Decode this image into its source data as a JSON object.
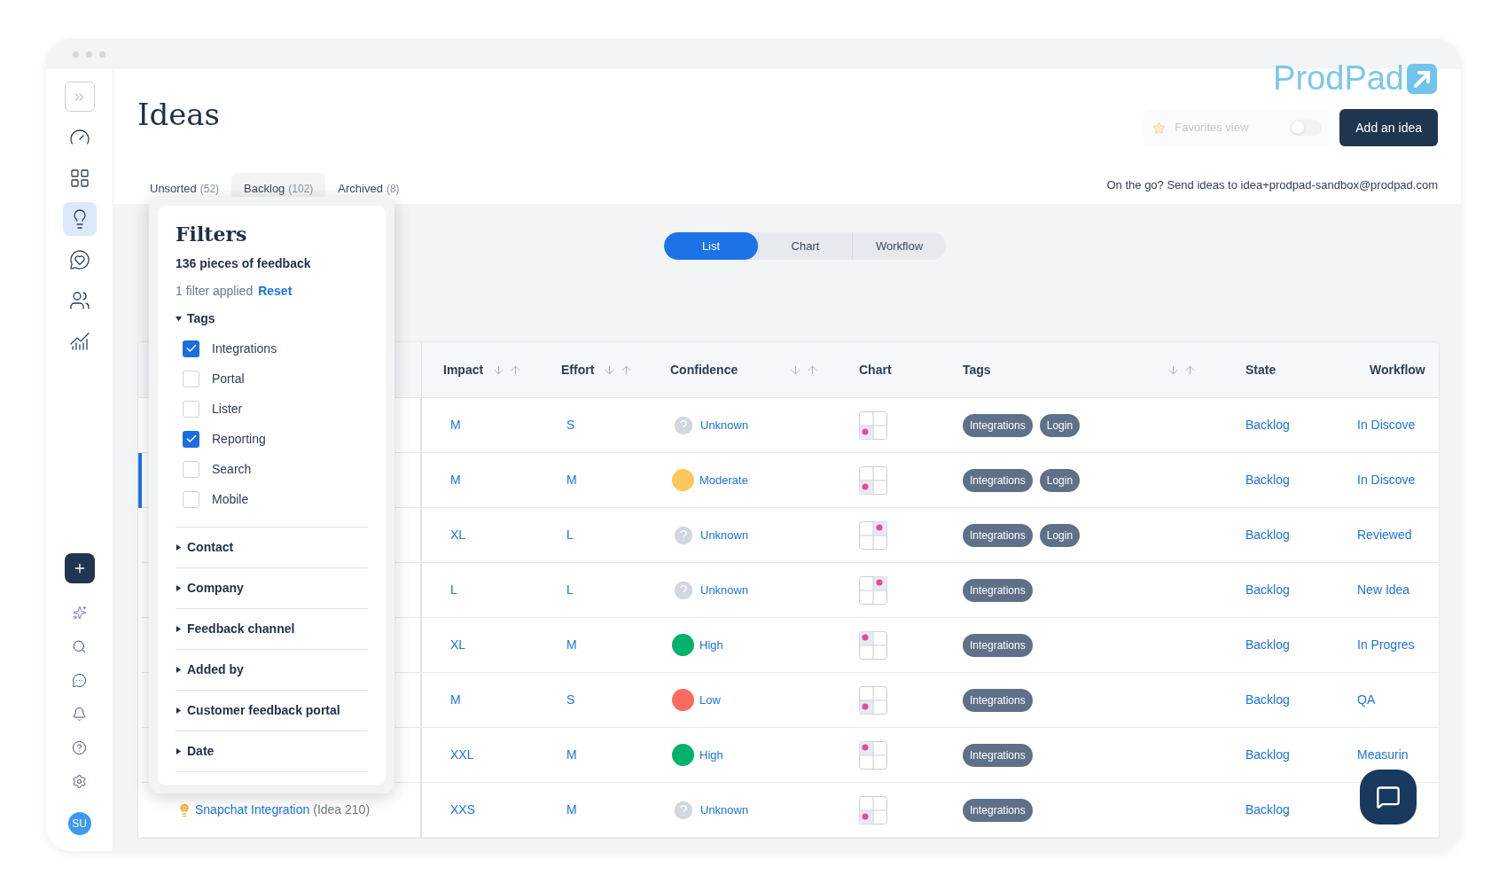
{
  "sidebar": {
    "top_items": [
      {
        "selected": false
      },
      {
        "selected": false
      },
      {
        "selected": true
      },
      {
        "selected": false
      },
      {
        "selected": false
      },
      {
        "selected": false
      }
    ],
    "avatar": "SU"
  },
  "header": {
    "title": "Ideas",
    "logo": "ProdPad",
    "favorites": {
      "label": "Favorites view",
      "on": false
    },
    "add_button": "Add an idea"
  },
  "tabs": [
    {
      "label": "Unsorted",
      "count": "(52)",
      "selected": false
    },
    {
      "label": "Backlog",
      "count": "(102)",
      "selected": true
    },
    {
      "label": "Archived",
      "count": "(8)",
      "selected": false
    }
  ],
  "email_note": "On the go? Send ideas to idea+prodpad-sandbox@prodpad.com",
  "views": [
    {
      "label": "List",
      "selected": true
    },
    {
      "label": "Chart",
      "selected": false
    },
    {
      "label": "Workflow",
      "selected": false
    }
  ],
  "table": {
    "columns": [
      {
        "label": "Impact",
        "sortable": true
      },
      {
        "label": "Effort",
        "sortable": true
      },
      {
        "label": "Confidence",
        "sortable": true
      },
      {
        "label": "Chart",
        "sortable": false
      },
      {
        "label": "Tags",
        "sortable": true
      },
      {
        "label": "State",
        "sortable": false
      },
      {
        "label": "Workflow",
        "sortable": false
      }
    ],
    "rows": [
      {
        "impact": "M",
        "effort": "S",
        "confidence": {
          "kind": "unknown",
          "label": "Unknown"
        },
        "chart": {
          "kind": "lowerleft"
        },
        "tags": [
          "Integrations",
          "Login"
        ],
        "state": "Backlog",
        "workflow": "In Discove",
        "selected": false
      },
      {
        "impact": "M",
        "effort": "M",
        "confidence": {
          "kind": "rated",
          "label": "Moderate",
          "color": "#fdc65e"
        },
        "chart": {
          "kind": "lowerleft"
        },
        "tags": [
          "Integrations",
          "Login"
        ],
        "state": "Backlog",
        "workflow": "In Discove",
        "selected": true
      },
      {
        "impact": "XL",
        "effort": "L",
        "confidence": {
          "kind": "unknown",
          "label": "Unknown"
        },
        "chart": {
          "kind": "upperright"
        },
        "tags": [
          "Integrations",
          "Login"
        ],
        "state": "Backlog",
        "workflow": "Reviewed",
        "selected": false
      },
      {
        "impact": "L",
        "effort": "L",
        "confidence": {
          "kind": "unknown",
          "label": "Unknown"
        },
        "chart": {
          "kind": "upperright"
        },
        "tags": [
          "Integrations"
        ],
        "state": "Backlog",
        "workflow": "New Idea",
        "selected": false
      },
      {
        "impact": "XL",
        "effort": "M",
        "confidence": {
          "kind": "rated",
          "label": "High",
          "color": "#00b26b"
        },
        "chart": {
          "kind": "upperleft"
        },
        "tags": [
          "Integrations"
        ],
        "state": "Backlog",
        "workflow": "In Progres",
        "selected": false
      },
      {
        "impact": "M",
        "effort": "S",
        "confidence": {
          "kind": "rated",
          "label": "Low",
          "color": "#fb6b5f"
        },
        "chart": {
          "kind": "lowerleft"
        },
        "tags": [
          "Integrations"
        ],
        "state": "Backlog",
        "workflow": "QA",
        "selected": false
      },
      {
        "impact": "XXL",
        "effort": "M",
        "confidence": {
          "kind": "rated",
          "label": "High",
          "color": "#00b26b"
        },
        "chart": {
          "kind": "upperleft"
        },
        "tags": [
          "Integrations"
        ],
        "state": "Backlog",
        "workflow": "Measurin",
        "selected": false
      },
      {
        "impact": "XXS",
        "effort": "M",
        "confidence": {
          "kind": "unknown",
          "label": "Unknown"
        },
        "chart": {
          "kind": "lowerleft"
        },
        "tags": [
          "Integrations"
        ],
        "state": "Backlog",
        "idea": {
          "name": "Snapchat Integration",
          "id": "(Idea 210)"
        },
        "selected": false
      }
    ]
  },
  "filters": {
    "title": "Filters",
    "count": "136 pieces of feedback",
    "applied": "1 filter applied",
    "reset": "Reset",
    "sections": [
      {
        "label": "Tags",
        "expanded": true,
        "options": [
          {
            "label": "Integrations",
            "checked": true
          },
          {
            "label": "Portal",
            "checked": false
          },
          {
            "label": "Lister",
            "checked": false
          },
          {
            "label": "Reporting",
            "checked": true
          },
          {
            "label": "Search",
            "checked": false
          },
          {
            "label": "Mobile",
            "checked": false
          }
        ]
      },
      {
        "label": "Contact",
        "expanded": false
      },
      {
        "label": "Company",
        "expanded": false
      },
      {
        "label": "Feedback channel",
        "expanded": false
      },
      {
        "label": "Added by",
        "expanded": false
      },
      {
        "label": "Customer feedback portal",
        "expanded": false
      },
      {
        "label": "Date",
        "expanded": false
      }
    ]
  }
}
